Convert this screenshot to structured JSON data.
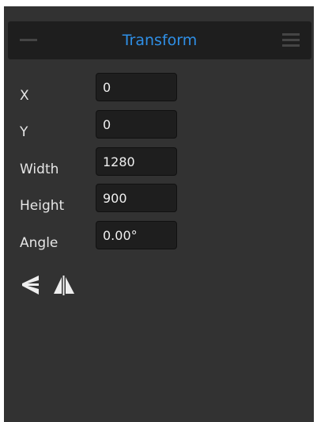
{
  "panel": {
    "title": "Transform"
  },
  "fields": {
    "x": {
      "label": "X",
      "value": "0"
    },
    "y": {
      "label": "Y",
      "value": "0"
    },
    "width": {
      "label": "Width",
      "value": "1280"
    },
    "height": {
      "label": "Height",
      "value": "900"
    },
    "angle": {
      "label": "Angle",
      "value": "0.00°"
    }
  },
  "icons": {
    "perspective": "perspective-icon",
    "flip_horizontal": "flip-horizontal-icon"
  },
  "colors": {
    "accent": "#2f8fe6",
    "panel_background": "#323232",
    "header_background": "#1e1e1e",
    "field_background": "#1e1e1e",
    "text": "#e6e6e6"
  }
}
